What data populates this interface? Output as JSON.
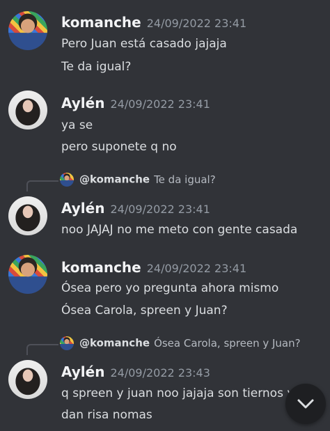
{
  "messages": [
    {
      "username": "komanche",
      "timestamp": "24/09/2022 23:41",
      "lines": [
        "Pero Juan está casado jajaja",
        "Te da igual?"
      ]
    },
    {
      "username": "Aylén",
      "timestamp": "24/09/2022 23:41",
      "lines": [
        "ya se",
        "pero suponete q no"
      ]
    },
    {
      "reply": {
        "mention": "@komanche",
        "snippet": "Te da igual?"
      },
      "username": "Aylén",
      "timestamp": "24/09/2022 23:41",
      "lines": [
        "noo JAJAJ no me meto con gente casada"
      ]
    },
    {
      "username": "komanche",
      "timestamp": "24/09/2022 23:41",
      "lines": [
        "Ósea pero yo pregunta ahora mismo",
        "Ósea Carola, spreen y Juan?"
      ]
    },
    {
      "reply": {
        "mention": "@komanche",
        "snippet": "Ósea Carola, spreen y Juan?"
      },
      "username": "Aylén",
      "timestamp": "24/09/2022 23:43",
      "lines": [
        "q spreen y juan noo jajaja son tiernos y",
        "dan risa nomas"
      ]
    }
  ],
  "scroll_button": {
    "icon": "chevron-down-icon"
  },
  "colors": {
    "background": "#313338",
    "username": "#f2f3f5",
    "timestamp": "#949ba4",
    "text": "#dbdee1"
  }
}
